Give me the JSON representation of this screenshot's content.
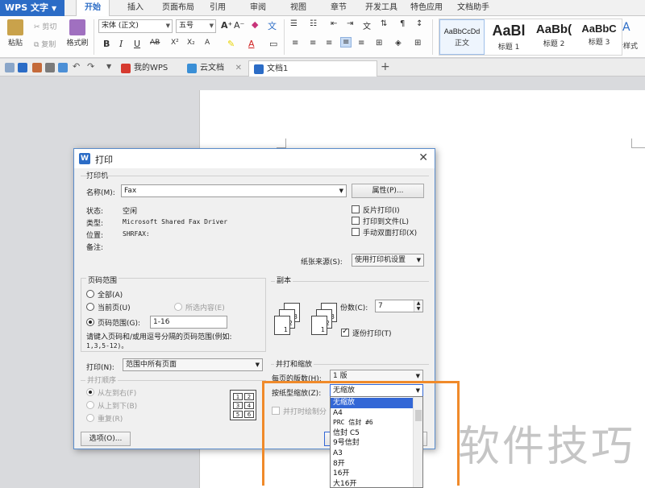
{
  "app": {
    "logo": "WPS 文字"
  },
  "ribbon_tabs": [
    "开始",
    "插入",
    "页面布局",
    "引用",
    "审阅",
    "视图",
    "章节",
    "开发工具",
    "特色应用",
    "文档助手"
  ],
  "active_tab": "开始",
  "ribbon": {
    "paste": "粘贴",
    "cut": "剪切",
    "copy": "复制",
    "format_painter": "格式刷",
    "font_name": "宋体 (正文)",
    "font_size": "五号",
    "bold": "B",
    "italic": "I",
    "underline": "U",
    "grow_font": "A⁺",
    "shrink_font": "A⁻",
    "styles": [
      {
        "preview": "AaBbCcDd",
        "name": "正文"
      },
      {
        "preview": "AaBl",
        "name": "标题 1"
      },
      {
        "preview": "AaBb(",
        "name": "标题 2"
      },
      {
        "preview": "AaBbC",
        "name": "标题 3"
      }
    ],
    "new_style": "新样式"
  },
  "doc_tabs": [
    {
      "label": "我的WPS"
    },
    {
      "label": "云文档"
    },
    {
      "label": "文档1"
    }
  ],
  "dialog": {
    "title": "打印",
    "printer_group": "打印机",
    "name_label": "名称(M):",
    "printer_name": "Fax",
    "properties_btn": "属性(P)...",
    "status_label": "状态:",
    "status_value": "空闲",
    "type_label": "类型:",
    "type_value": "Microsoft Shared Fax Driver",
    "where_label": "位置:",
    "where_value": "SHRFAX:",
    "comment_label": "备注:",
    "reverse_print": "反片打印(I)",
    "print_to_file": "打印到文件(L)",
    "manual_duplex": "手动双面打印(X)",
    "paper_source_label": "纸张来源(S):",
    "paper_source_value": "使用打印机设置",
    "page_range_group": "页码范围",
    "all_pages": "全部(A)",
    "current_page": "当前页(U)",
    "selection": "所选内容(E)",
    "page_range": "页码范围(G):",
    "page_range_value": "1-16",
    "page_range_hint": "请键入页码和/或用逗号分隔的页码范围(例如:",
    "page_range_hint2": "1,3,5-12)。",
    "copies_group": "副本",
    "copies_label": "份数(C):",
    "copies_value": "7",
    "collate": "逐份打印(T)",
    "print_label": "打印(N):",
    "print_value": "范围中所有页面",
    "print_order": "并打顺序",
    "order_lr": "从左到右(F)",
    "order_tb": "从上到下(B)",
    "order_repeat": "重复(R)",
    "zoom_group": "并打和缩放",
    "pages_per_sheet_label": "每页的版数(H):",
    "pages_per_sheet_value": "1 版",
    "scale_label": "按纸型缩放(Z):",
    "scale_value": "无缩放",
    "draw_borders": "并打时绘制分",
    "options_btn": "选项(O)...",
    "scale_options": [
      "无缩放",
      "A4",
      "PRC 信封 #6",
      "信封 C5",
      "9号信封",
      "A3",
      "8开",
      "16开",
      "大16开"
    ],
    "grid_numbers": [
      "1",
      "2",
      "3",
      "4",
      "5",
      "6"
    ]
  },
  "watermark": "软件技巧",
  "colors": {
    "accent": "#2b6cc6",
    "highlight": "#f08a2a",
    "selection": "#3367d6"
  }
}
